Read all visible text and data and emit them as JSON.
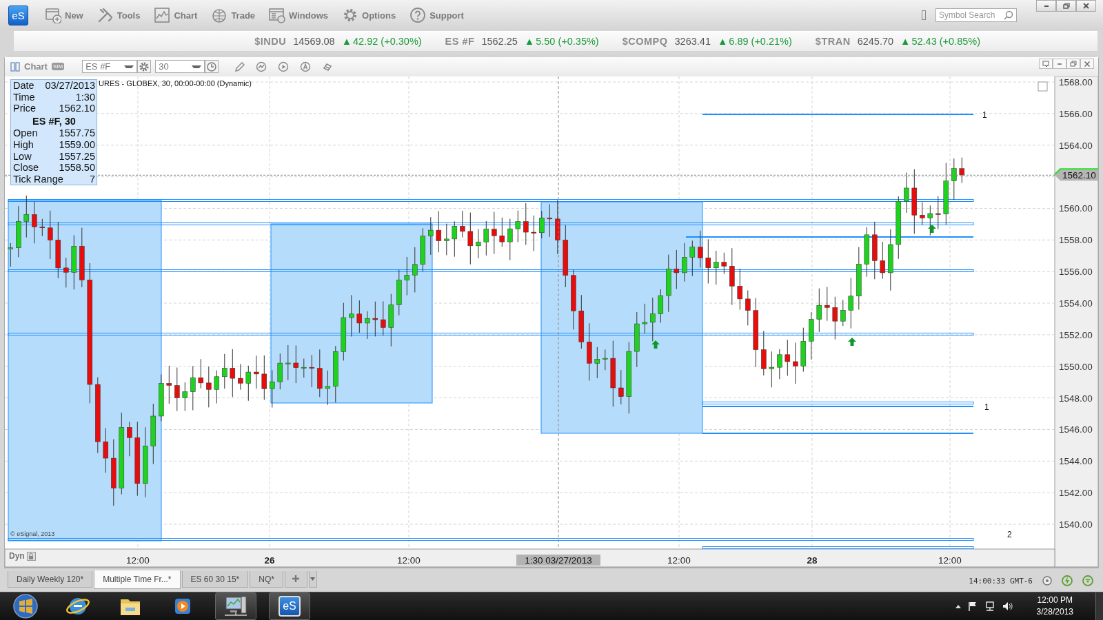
{
  "app_toolbar": {
    "logo": "eS",
    "buttons": [
      {
        "label": "New",
        "kind": "new"
      },
      {
        "label": "Tools",
        "kind": "tools"
      },
      {
        "label": "Chart",
        "kind": "chart"
      },
      {
        "label": "Trade",
        "kind": "trade"
      },
      {
        "label": "Windows",
        "kind": "windows"
      },
      {
        "label": "Options",
        "kind": "options"
      },
      {
        "label": "Support",
        "kind": "support"
      }
    ],
    "search": {
      "placeholder": "Symbol Search"
    }
  },
  "ticker": [
    {
      "symbol": "$INDU",
      "last": "14569.08",
      "arrow": "▲",
      "change": "42.92 (+0.30%)"
    },
    {
      "symbol": "ES #F",
      "last": "1562.25",
      "arrow": "▲",
      "change": "5.50 (+0.35%)"
    },
    {
      "symbol": "$COMPQ",
      "last": "3263.41",
      "arrow": "▲",
      "change": "6.89 (+0.21%)"
    },
    {
      "symbol": "$TRAN",
      "last": "6245.70",
      "arrow": "▲",
      "change": "52.43 (+0.85%)"
    }
  ],
  "chart_window": {
    "title": "Chart",
    "badge": "SIM",
    "symbol": "ES #F",
    "interval": "30",
    "legend": "URES - GLOBEX, 30, 00:00-00:00 (Dynamic)",
    "data_window": {
      "rows": [
        {
          "label": "Date",
          "value": "03/27/2013"
        },
        {
          "label": "Time",
          "value": "1:30"
        },
        {
          "label": "Price",
          "value": "1562.10"
        }
      ],
      "heading": "ES #F, 30",
      "bar_rows": [
        {
          "label": "Open",
          "value": "1557.75"
        },
        {
          "label": "High",
          "value": "1559.00"
        },
        {
          "label": "Low",
          "value": "1557.25"
        },
        {
          "label": "Close",
          "value": "1558.50"
        },
        {
          "label": "Tick Range",
          "value": "7"
        }
      ]
    },
    "price_axis": [
      "1568.00",
      "1566.00",
      "1564.00",
      "1560.00",
      "1558.00",
      "1556.00",
      "1554.00",
      "1552.00",
      "1550.00",
      "1548.00",
      "1546.00",
      "1544.00",
      "1542.00",
      "1540.00"
    ],
    "current_price": "1562.10",
    "time_axis": [
      {
        "label": "12:00",
        "kind": "tick"
      },
      {
        "label": "26",
        "kind": "day"
      },
      {
        "label": "12:00",
        "kind": "tick"
      },
      {
        "label": "1:30 03/27/2013",
        "kind": "cursor"
      },
      {
        "label": "12:00",
        "kind": "tick"
      },
      {
        "label": "28",
        "kind": "day"
      },
      {
        "label": "12:00",
        "kind": "tick"
      }
    ],
    "line_labels": [
      "1",
      "1",
      "2"
    ],
    "copyright": "© eSignal, 2013",
    "mode": "Dyn"
  },
  "tabs": [
    {
      "label": "Daily Weekly 120*",
      "selected": false
    },
    {
      "label": "Multiple Time Fr...*",
      "selected": true
    },
    {
      "label": "ES 60 30 15*",
      "selected": false
    },
    {
      "label": "NQ*",
      "selected": false
    }
  ],
  "status": {
    "time": "14:00:33 GMT-6"
  },
  "taskbar": {
    "apps": [
      {
        "kind": "start"
      },
      {
        "kind": "browser"
      },
      {
        "kind": "folder"
      },
      {
        "kind": "media"
      },
      {
        "kind": "network"
      },
      {
        "kind": "logo",
        "label": "eS"
      }
    ],
    "time": "12:00 PM",
    "date": "3/28/2013"
  }
}
